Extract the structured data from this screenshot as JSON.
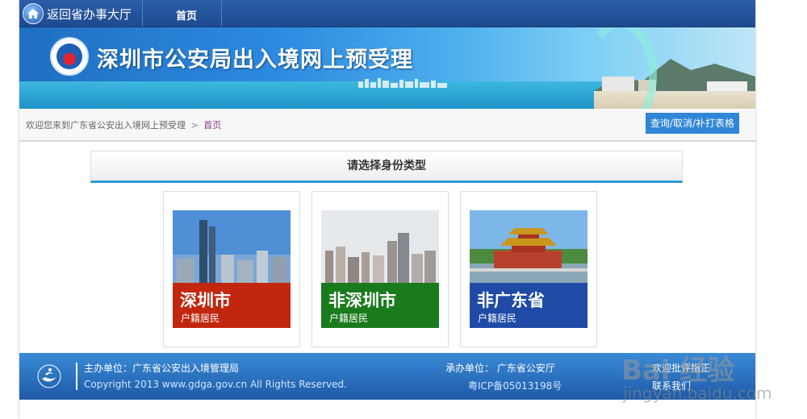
{
  "topnav": {
    "back_label": "返回省办事大厅",
    "home_label": "首页"
  },
  "banner": {
    "title": "深圳市公安局出入境网上预受理"
  },
  "breadcrumb": {
    "prefix": "欢迎您来到广东省公安出入境网上预受理",
    "separator": ">",
    "current": "首页"
  },
  "actions": {
    "query_button": "查询/取消/补打表格"
  },
  "identity": {
    "heading": "请选择身份类型",
    "cards": [
      {
        "title": "深圳市",
        "subtitle": "户籍居民",
        "color": "#c1270f"
      },
      {
        "title": "非深圳市",
        "subtitle": "户籍居民",
        "color": "#1a7b1d"
      },
      {
        "title": "非广东省",
        "subtitle": "户籍居民",
        "color": "#1f4aa6"
      }
    ]
  },
  "footer": {
    "host": "主办单位：广东省公安出入境管理局",
    "copyright": "Copyright 2013 www.gdga.gov.cn All Rights Reserved.",
    "organizer": "承办单位： 广东省公安厅",
    "icp": "粤ICP备05013198号",
    "welcome": "欢迎批评指正",
    "contact": "联系我们"
  },
  "watermark": {
    "brand": "Bai 经验",
    "url": "jingyan.baidu.com"
  }
}
